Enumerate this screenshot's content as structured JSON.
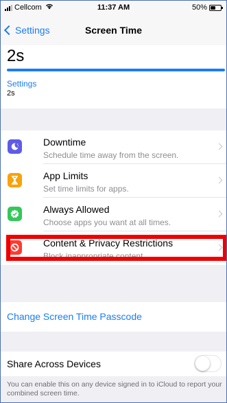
{
  "status_bar": {
    "carrier": "Cellcom",
    "wifi_icon": "wifi-icon",
    "time": "11:37 AM",
    "battery_percent_text": "50%",
    "battery_level": 0.5
  },
  "nav": {
    "back_label": "Settings",
    "title": "Screen Time"
  },
  "usage": {
    "value": "2s",
    "section_label": "Settings",
    "section_value": "2s",
    "bar_fill": 1.0
  },
  "features": [
    {
      "icon": "downtime-icon",
      "icon_color": "#5e5ce6",
      "title": "Downtime",
      "desc": "Schedule time away from the screen."
    },
    {
      "icon": "app-limits-icon",
      "icon_color": "#f7a30b",
      "title": "App Limits",
      "desc": "Set time limits for apps."
    },
    {
      "icon": "always-allowed-icon",
      "icon_color": "#34c759",
      "title": "Always Allowed",
      "desc": "Choose apps you want at all times."
    },
    {
      "icon": "restrictions-icon",
      "icon_color": "#ff3b30",
      "title": "Content & Privacy Restrictions",
      "desc": "Block inappropriate content."
    }
  ],
  "passcode": {
    "label": "Change Screen Time Passcode"
  },
  "share": {
    "label": "Share Across Devices",
    "enabled": false,
    "note": "You can enable this on any device signed in to iCloud to report your combined screen time."
  },
  "colors": {
    "accent": "#1a7cf5",
    "highlight": "#f00000",
    "background": "#efeff4"
  }
}
